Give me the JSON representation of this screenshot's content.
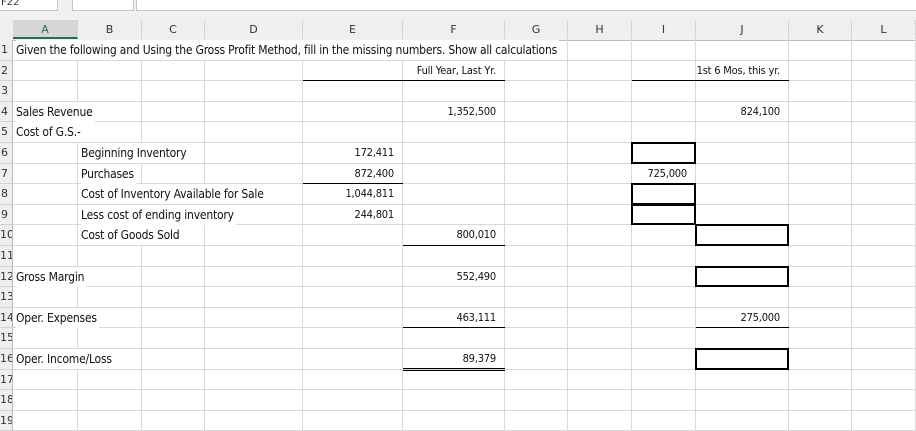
{
  "name_box": "F22",
  "formula_icons": [
    "cancel-icon",
    "enter-icon",
    "function-icon"
  ],
  "columns": [
    "A",
    "B",
    "C",
    "D",
    "E",
    "F",
    "G",
    "H",
    "I",
    "J",
    "K",
    "L"
  ],
  "selected_column": "A",
  "rows": [
    "1",
    "2",
    "3",
    "4",
    "5",
    "6",
    "7",
    "8",
    "9",
    "10",
    "11",
    "12",
    "13",
    "14",
    "15",
    "16",
    "17",
    "18",
    "19"
  ],
  "cells": {
    "A1": "Given the following and Using the Gross Profit Method, fill in the missing numbers. Show all calculations",
    "F2": "Full Year, Last Yr.",
    "J2": "1st 6 Mos, this yr.",
    "A4": "Sales Revenue",
    "F4": "1,352,500",
    "J4": "824,100",
    "A5": "Cost of G.S.-",
    "B6": "Beginning Inventory",
    "E6": "172,411",
    "B7": "Purchases",
    "E7": "872,400",
    "I7": "725,000",
    "B8": "Cost of Inventory Available for Sale",
    "E8": "1,044,811",
    "B9": "Less cost of ending inventory",
    "E9": "244,801",
    "B10": "Cost of Goods Sold",
    "F10": "800,010",
    "A12": "Gross Margin",
    "F12": "552,490",
    "A14": "Oper. Expenses",
    "F14": "463,111",
    "J14": "275,000",
    "A16": "Oper. Income/Loss",
    "F16": "89,379"
  },
  "answer_cells": [
    "I6",
    "I8",
    "I9",
    "J10",
    "J12",
    "J16"
  ]
}
